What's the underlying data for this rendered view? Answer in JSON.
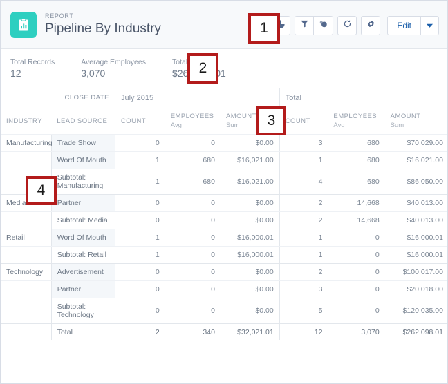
{
  "header": {
    "eyebrow": "REPORT",
    "title": "Pipeline By Industry",
    "icon": "report-clipboard-icon",
    "accent_color": "#2ecfc0",
    "toolbar": {
      "chart_icon": "pie-chart-icon",
      "filter_icon": "funnel-filter-icon",
      "conditional_icon": "chart-bubble-icon",
      "refresh_icon": "refresh-icon",
      "settings_icon": "gear-icon",
      "edit_label": "Edit",
      "caret_icon": "chevron-down-icon"
    }
  },
  "summary": {
    "stats": [
      {
        "label": "Total Records",
        "value": "12"
      },
      {
        "label": "Average Employees",
        "value": "3,070"
      },
      {
        "label": "Total Amount",
        "value": "$262,098.01"
      }
    ]
  },
  "table": {
    "group_header": {
      "label": "CLOSE DATE",
      "period": "July 2015",
      "total": "Total"
    },
    "columns": {
      "industry": "INDUSTRY",
      "lead_source": "LEAD SOURCE",
      "count": "COUNT",
      "employees": "EMPLOYEES",
      "employees_sub": "Avg",
      "amount": "AMOUNT",
      "amount_sub": "Sum",
      "count_total": "COUNT",
      "employees_total": "EMPLOYEES",
      "employees_total_sub": "Avg",
      "amount_total": "AMOUNT",
      "amount_total_sub": "Sum"
    },
    "rows": [
      {
        "industry": "Manufacturing",
        "lead": "Trade Show",
        "count": "0",
        "emp": "0",
        "amt": "$0.00",
        "count2": "3",
        "emp2": "680",
        "amt2": "$70,029.00",
        "type": "data",
        "group_start": true
      },
      {
        "industry": "",
        "lead": "Word Of Mouth",
        "count": "1",
        "emp": "680",
        "amt": "$16,021.00",
        "count2": "1",
        "emp2": "680",
        "amt2": "$16,021.00",
        "type": "data",
        "group_start": false
      },
      {
        "industry": "",
        "lead": "Subtotal: Manufacturing",
        "count": "1",
        "emp": "680",
        "amt": "$16,021.00",
        "count2": "4",
        "emp2": "680",
        "amt2": "$86,050.00",
        "type": "subtotal",
        "group_start": false
      },
      {
        "industry": "Media",
        "lead": "Partner",
        "count": "0",
        "emp": "0",
        "amt": "$0.00",
        "count2": "2",
        "emp2": "14,668",
        "amt2": "$40,013.00",
        "type": "data",
        "group_start": true
      },
      {
        "industry": "",
        "lead": "Subtotal: Media",
        "count": "0",
        "emp": "0",
        "amt": "$0.00",
        "count2": "2",
        "emp2": "14,668",
        "amt2": "$40,013.00",
        "type": "subtotal",
        "group_start": false
      },
      {
        "industry": "Retail",
        "lead": "Word Of Mouth",
        "count": "1",
        "emp": "0",
        "amt": "$16,000.01",
        "count2": "1",
        "emp2": "0",
        "amt2": "$16,000.01",
        "type": "data",
        "group_start": true
      },
      {
        "industry": "",
        "lead": "Subtotal: Retail",
        "count": "1",
        "emp": "0",
        "amt": "$16,000.01",
        "count2": "1",
        "emp2": "0",
        "amt2": "$16,000.01",
        "type": "subtotal",
        "group_start": false
      },
      {
        "industry": "Technology",
        "lead": "Advertisement",
        "count": "0",
        "emp": "0",
        "amt": "$0.00",
        "count2": "2",
        "emp2": "0",
        "amt2": "$100,017.00",
        "type": "data",
        "group_start": true
      },
      {
        "industry": "",
        "lead": "Partner",
        "count": "0",
        "emp": "0",
        "amt": "$0.00",
        "count2": "3",
        "emp2": "0",
        "amt2": "$20,018.00",
        "type": "data",
        "group_start": false
      },
      {
        "industry": "",
        "lead": "Subtotal: Technology",
        "count": "0",
        "emp": "0",
        "amt": "$0.00",
        "count2": "5",
        "emp2": "0",
        "amt2": "$120,035.00",
        "type": "subtotal",
        "group_start": false
      },
      {
        "industry": "",
        "lead": "Total",
        "count": "2",
        "emp": "340",
        "amt": "$32,021.01",
        "count2": "12",
        "emp2": "3,070",
        "amt2": "$262,098.01",
        "type": "grand",
        "group_start": false
      }
    ]
  },
  "annotations": [
    {
      "id": "anno-1",
      "label": "1"
    },
    {
      "id": "anno-2",
      "label": "2"
    },
    {
      "id": "anno-3",
      "label": "3"
    },
    {
      "id": "anno-4",
      "label": "4"
    }
  ]
}
